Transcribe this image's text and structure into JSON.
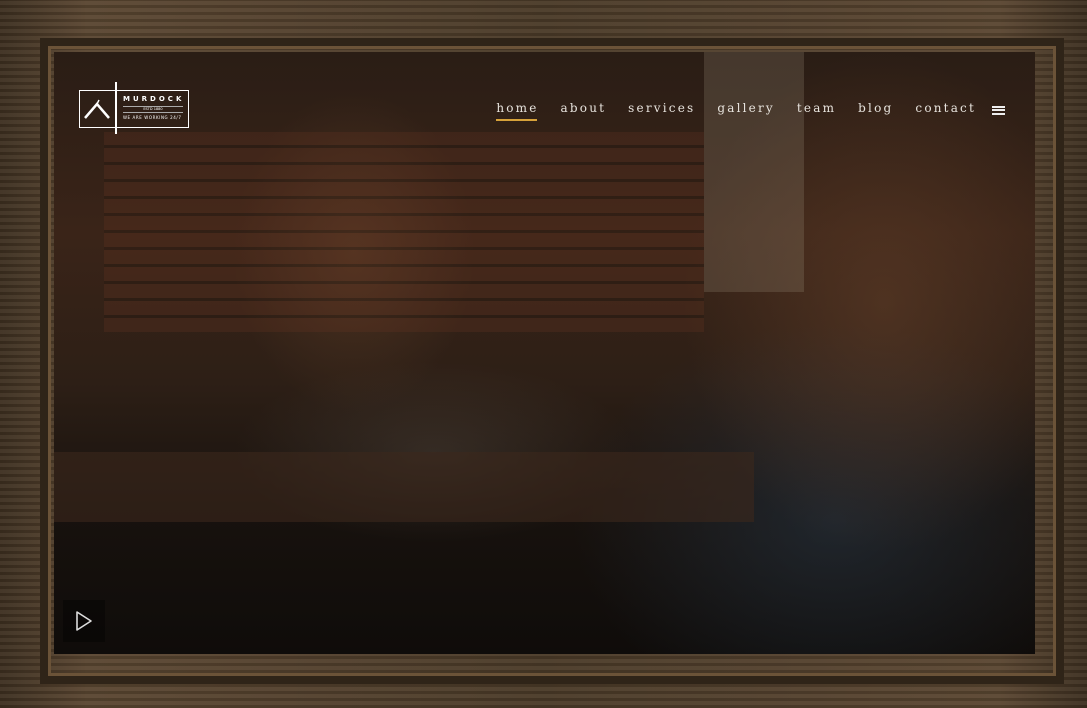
{
  "logo": {
    "name": "MURDOCK",
    "established": "ESTD 1880",
    "tagline": "WE ARE WORKING 24/7"
  },
  "nav": {
    "items": [
      {
        "label": "home",
        "active": true
      },
      {
        "label": "about"
      },
      {
        "label": "services"
      },
      {
        "label": "gallery"
      },
      {
        "label": "team"
      },
      {
        "label": "blog"
      },
      {
        "label": "contact"
      }
    ],
    "menu_icon": "hamburger-icon"
  },
  "hero": {
    "play_icon": "play-icon"
  },
  "colors": {
    "accent": "#d7a23a",
    "frame": "#4a3a28"
  }
}
